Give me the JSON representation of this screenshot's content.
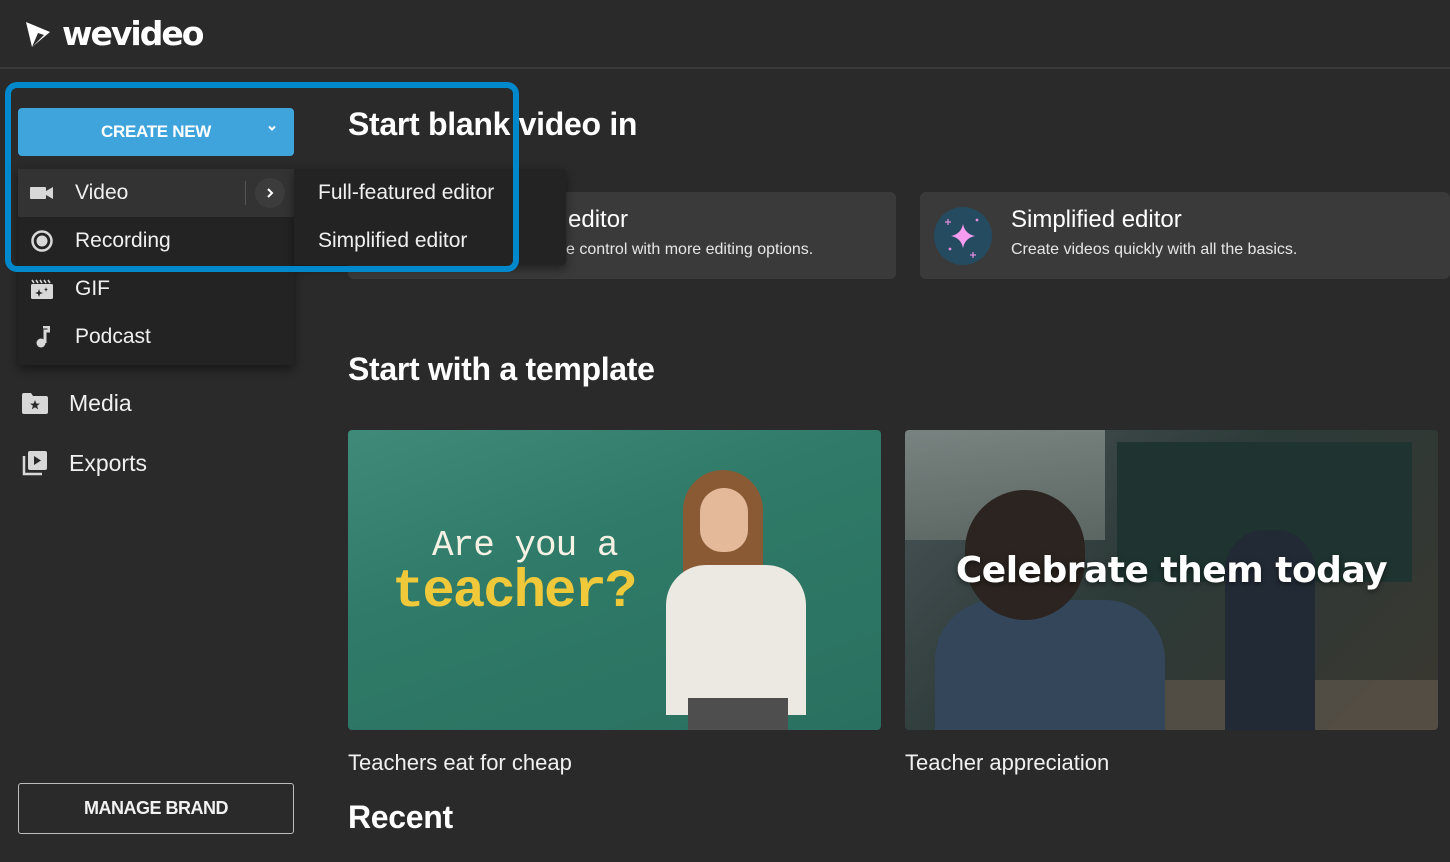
{
  "app": {
    "brand": "wevideo",
    "accent_color": "#40a4dc",
    "highlight_color": "#0088cc"
  },
  "sidebar": {
    "create_new": {
      "label": "CREATE NEW",
      "icon": "chevron-down-icon"
    },
    "dropdown": [
      {
        "label": "Video",
        "icon": "video-camera-icon",
        "has_submenu": true
      },
      {
        "label": "Recording",
        "icon": "record-icon"
      },
      {
        "label": "GIF",
        "icon": "gif-clapper-icon"
      },
      {
        "label": "Podcast",
        "icon": "music-note-icon"
      }
    ],
    "submenu": [
      {
        "label": "Full-featured editor"
      },
      {
        "label": "Simplified editor"
      }
    ],
    "nav": [
      {
        "label": "Media",
        "icon": "media-folder-icon"
      },
      {
        "label": "Exports",
        "icon": "exports-icon"
      }
    ],
    "manage_brand": "MANAGE BRAND"
  },
  "main": {
    "blank_heading": "Start blank video in",
    "editors": [
      {
        "title": "Full-featured editor",
        "visible_title": "d editor",
        "desc": "Take control with more editing options.",
        "visible_desc": "e control with more editing options."
      },
      {
        "title": "Simplified editor",
        "desc": "Create videos quickly with all the basics.",
        "icon": "sparkle-icon"
      }
    ],
    "template_heading": "Start with a template",
    "templates": [
      {
        "label": "Teachers eat for cheap",
        "thumb_line1": "Are you a",
        "thumb_line2": "teacher?"
      },
      {
        "label": "Teacher appreciation",
        "thumb_text": "Celebrate them today"
      }
    ],
    "recent_heading": "Recent"
  }
}
